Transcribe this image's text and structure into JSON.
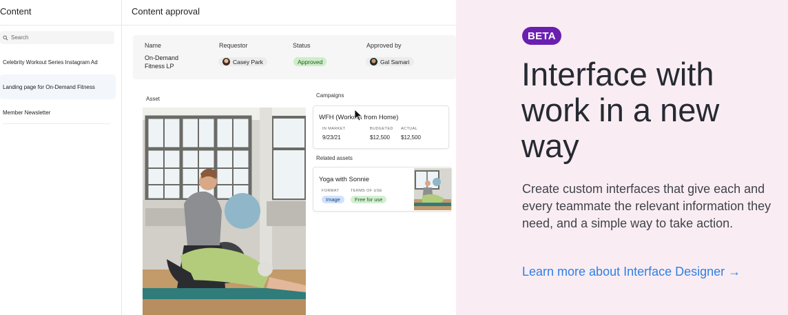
{
  "sidebar": {
    "title": "Content",
    "search_placeholder": "Search",
    "items": [
      {
        "label": "Celebrity Workout Series Instagram Ad"
      },
      {
        "label": "Landing page for On-Demand Fitness"
      },
      {
        "label": "Member Newsletter"
      }
    ]
  },
  "main": {
    "title": "Content approval",
    "record": {
      "headers": [
        "Name",
        "Requestor",
        "Status",
        "Approved by"
      ],
      "name": "On-Demand Fitness LP",
      "requestor": "Casey Park",
      "status": "Approved",
      "approved_by": "Gal Samari"
    },
    "asset_label": "Asset",
    "campaigns_label": "Campaigns",
    "campaign": {
      "title": "WFH (Workout from Home)",
      "cols": [
        "IN MARKET",
        "BUDGETED",
        "ACTUAL"
      ],
      "in_market": "9/23/21",
      "budgeted": "$12,500",
      "actual": "$12,500"
    },
    "related_label": "Related assets",
    "related": {
      "title": "Yoga with Sonnie",
      "cols": [
        "FORMAT",
        "TERMS OF USE"
      ],
      "format": "Image",
      "terms": "Free for use"
    }
  },
  "promo": {
    "badge": "BETA",
    "headline": "Interface with work in a new way",
    "subtext": "Create custom interfaces that give each and every teammate the relevant information they need, and a simple way to take action.",
    "link": "Learn more about Interface Designer →"
  },
  "colors": {
    "promo_bg": "#f9edf3",
    "beta_bg": "#6a1fb0",
    "link": "#2f7fe3",
    "status_pill": "#cdeec8",
    "format_tag": "#cfe2fb",
    "terms_tag": "#d3efd2"
  }
}
